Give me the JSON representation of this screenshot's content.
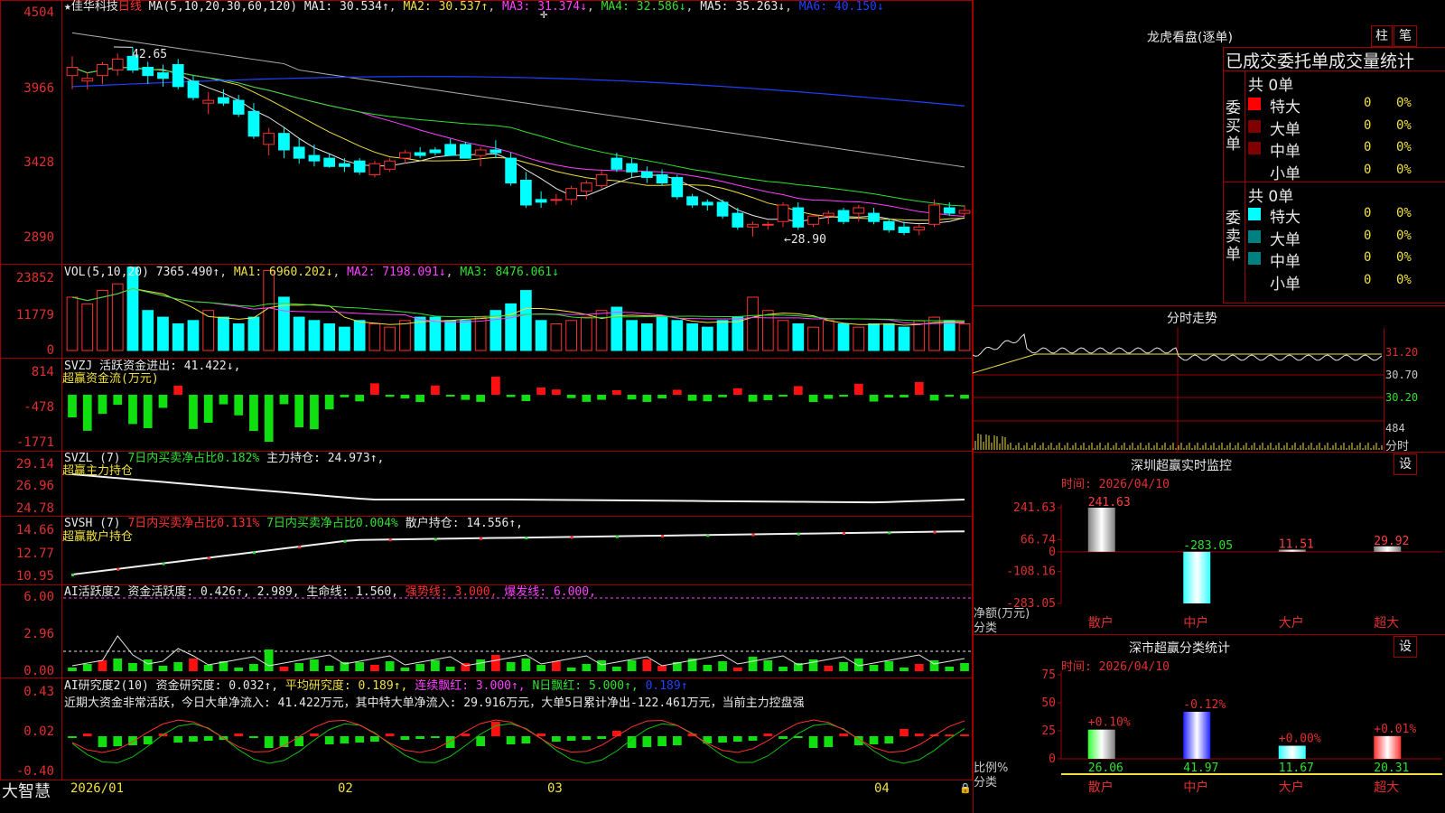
{
  "left": {
    "main": {
      "name": "★佳华科技",
      "period": "日线",
      "ma_params": "MA(5,10,20,30,60,120)",
      "ma1": "MA1: 30.534↑",
      "ma2": "MA2: 30.537↑",
      "ma3": "MA3: 31.374↓",
      "ma4": "MA4: 32.586↓",
      "ma5": "MA5: 35.263↓",
      "ma6": "MA6: 40.150↓",
      "y_ticks": [
        "4504",
        "3966",
        "3428",
        "2890"
      ],
      "high_mark": "42.65",
      "low_mark": "←28.90"
    },
    "vol": {
      "head": "VOL(5,10,20)",
      "value": "7365.490↑",
      "ma1": "MA1: 6960.202↓",
      "ma2": "MA2: 7198.091↓",
      "ma3": "MA3: 8476.061↓",
      "y_ticks": [
        "23852",
        "11779",
        "0"
      ]
    },
    "svzj": {
      "head": "SVZJ",
      "text": "活跃资金进出: 41.422↓,",
      "sub": "超赢资金流(万元)",
      "y_ticks": [
        "814",
        "-478",
        "-1771"
      ]
    },
    "svzl": {
      "head": "SVZL (7)",
      "t1": "7日内买卖净占比0.182%",
      "t2": "主力持仓: 24.973↑,",
      "sub": "超赢主力持仓",
      "y_ticks": [
        "29.14",
        "26.96",
        "24.78"
      ]
    },
    "svsh": {
      "head": "SVSH (7)",
      "t1": "7日内买卖净占比0.131%",
      "t2": "7日内买卖净占比0.004%",
      "t3": "散户持仓: 14.556↑,",
      "sub": "超赢散户持仓",
      "y_ticks": [
        "14.66",
        "12.77",
        "10.95"
      ]
    },
    "ai1": {
      "head": "AI活跃度2",
      "t1": "资金活跃度: 0.426↑,",
      "t2": "2.989,",
      "t3": "生命线: 1.560,",
      "t4": "强势线: 3.000,",
      "t5": "爆发线: 6.000,",
      "y_ticks": [
        "6.00",
        "2.96",
        "0.00"
      ]
    },
    "ai2": {
      "head": "AI研究度2(10)",
      "t1": "资金研究度: 0.032↑,",
      "t2": "平均研究度: 0.189↑,",
      "t3": "连续飘红: 3.000↑,",
      "t4": "N日飘红: 5.000↑,",
      "t5": "0.189↑",
      "note": "近期大资金非常活跃，今日大单净流入: 41.422万元，其中特大单净流入: 29.916万元，大单5日累计净出-122.461万元，当前主力控盘强",
      "y_ticks": [
        "0.43",
        "0.02",
        "-0.40"
      ]
    },
    "footer": {
      "brand": "大智慧",
      "dates": [
        "2026/01",
        "02",
        "03",
        "04"
      ]
    }
  },
  "right": {
    "lhb": {
      "title": "龙虎看盘(逐单)",
      "btn1": "柱",
      "btn2": "笔",
      "header": "已成交委托单成交量统计",
      "buy_label": "委买单",
      "sell_label": "委卖单",
      "buy_total": "共 0单",
      "sell_total": "共 0单",
      "rows": [
        "特大",
        "大单",
        "中单",
        "小单"
      ],
      "buy_colors": [
        "#ff0000",
        "#800000",
        "#800000",
        "#000000"
      ],
      "sell_colors": [
        "#00ffff",
        "#008080",
        "#008080",
        "#000000"
      ],
      "count": "0",
      "pct": "0%"
    },
    "fenshi": {
      "title": "分时走势",
      "y_ticks": [
        "31.20",
        "30.70",
        "30.20"
      ],
      "vol_tick": "484",
      "vol_label": "分时"
    },
    "sz": {
      "title": "深圳超赢实时监控",
      "btn": "设",
      "time": "时间: 2026/04/10",
      "y_ticks": [
        "241.63",
        "66.74",
        "0",
        "-108.16",
        "-283.05"
      ],
      "ylabel1": "净额(万元)",
      "ylabel2": "分类",
      "categories": [
        "散户",
        "中户",
        "大户",
        "超大"
      ],
      "values": [
        "241.63",
        "-283.05",
        "11.51",
        "29.92"
      ]
    },
    "sm": {
      "title": "深市超赢分类统计",
      "btn": "设",
      "time": "时间: 2026/04/10",
      "y_ticks": [
        "75",
        "50",
        "25",
        "0"
      ],
      "ylabel1": "比例%",
      "ylabel2": "分类",
      "categories": [
        "散户",
        "中户",
        "大户",
        "超大"
      ],
      "values": [
        "26.06",
        "41.97",
        "11.67",
        "20.31"
      ],
      "changes": [
        "+0.10%",
        "-0.12%",
        "+0.00%",
        "+0.01%"
      ]
    }
  },
  "chart_data": [
    {
      "type": "bar",
      "title": "深圳超赢实时监控",
      "ylabel": "净额(万元)",
      "categories": [
        "散户",
        "中户",
        "大户",
        "超大"
      ],
      "values": [
        241.63,
        -283.05,
        11.51,
        29.92
      ],
      "ylim": [
        -283.05,
        241.63
      ]
    },
    {
      "type": "bar",
      "title": "深市超赢分类统计",
      "ylabel": "比例%",
      "categories": [
        "散户",
        "中户",
        "大户",
        "超大"
      ],
      "values": [
        26.06,
        41.97,
        11.67,
        20.31
      ],
      "ylim": [
        0,
        75
      ]
    },
    {
      "type": "line",
      "title": "日线",
      "ylim": [
        28.9,
        45.04
      ],
      "candles": [
        [
          40.6,
          42.0,
          39.6,
          41.2
        ],
        [
          40.2,
          40.8,
          39.6,
          40.4
        ],
        [
          40.6,
          41.6,
          40.0,
          41.4
        ],
        [
          41.0,
          42.2,
          40.6,
          41.8
        ],
        [
          42.0,
          42.65,
          40.8,
          41.0
        ],
        [
          41.2,
          41.6,
          40.0,
          40.6
        ],
        [
          40.8,
          41.4,
          39.8,
          40.4
        ],
        [
          41.4,
          41.8,
          39.6,
          39.8
        ],
        [
          40.2,
          40.6,
          38.8,
          39.0
        ],
        [
          38.6,
          39.4,
          37.8,
          38.8
        ],
        [
          39.0,
          39.6,
          38.4,
          38.6
        ],
        [
          38.8,
          39.2,
          37.6,
          37.8
        ],
        [
          38.0,
          38.6,
          36.0,
          36.2
        ],
        [
          35.6,
          36.8,
          34.8,
          36.4
        ],
        [
          36.4,
          36.8,
          34.6,
          35.2
        ],
        [
          35.4,
          36.0,
          34.2,
          34.6
        ],
        [
          34.8,
          35.6,
          34.0,
          34.4
        ],
        [
          34.6,
          34.9,
          33.9,
          34.0
        ],
        [
          34.2,
          34.6,
          33.6,
          34.0
        ],
        [
          34.4,
          34.6,
          33.4,
          33.6
        ],
        [
          33.4,
          34.4,
          33.2,
          34.2
        ],
        [
          33.8,
          34.6,
          33.6,
          34.4
        ],
        [
          34.6,
          35.2,
          34.2,
          35.0
        ],
        [
          35.0,
          35.4,
          34.6,
          34.8
        ],
        [
          35.2,
          35.4,
          34.8,
          35.0
        ],
        [
          35.6,
          36.0,
          34.8,
          34.8
        ],
        [
          35.6,
          35.8,
          34.6,
          34.6
        ],
        [
          34.8,
          35.4,
          34.0,
          35.2
        ],
        [
          35.2,
          35.9,
          34.6,
          35.0
        ],
        [
          34.6,
          35.0,
          32.6,
          32.8
        ],
        [
          33.0,
          33.6,
          31.0,
          31.2
        ],
        [
          31.6,
          32.2,
          31.0,
          31.4
        ],
        [
          31.6,
          32.0,
          31.2,
          31.6
        ],
        [
          31.6,
          32.6,
          31.2,
          32.4
        ],
        [
          32.2,
          33.0,
          31.6,
          32.8
        ],
        [
          32.6,
          33.8,
          32.4,
          33.4
        ],
        [
          34.6,
          35.0,
          33.6,
          33.8
        ],
        [
          34.2,
          34.6,
          33.2,
          33.6
        ],
        [
          33.6,
          34.0,
          32.8,
          33.2
        ],
        [
          33.4,
          33.8,
          32.6,
          32.8
        ],
        [
          33.2,
          33.4,
          31.6,
          31.8
        ],
        [
          31.8,
          32.0,
          31.0,
          31.2
        ],
        [
          31.4,
          31.6,
          30.8,
          31.2
        ],
        [
          31.4,
          31.6,
          30.2,
          30.4
        ],
        [
          30.6,
          31.0,
          29.4,
          29.6
        ],
        [
          29.6,
          30.0,
          28.9,
          29.8
        ],
        [
          29.8,
          30.0,
          29.4,
          29.8
        ],
        [
          30.0,
          31.4,
          29.6,
          31.2
        ],
        [
          31.0,
          31.4,
          29.4,
          29.6
        ],
        [
          29.8,
          30.4,
          29.6,
          30.4
        ],
        [
          30.4,
          30.8,
          29.8,
          30.6
        ],
        [
          30.8,
          31.0,
          29.8,
          30.0
        ],
        [
          30.6,
          31.2,
          30.0,
          31.0
        ],
        [
          30.6,
          31.0,
          29.8,
          30.0
        ],
        [
          30.0,
          30.2,
          29.2,
          29.4
        ],
        [
          29.6,
          30.0,
          29.0,
          29.2
        ],
        [
          29.4,
          29.8,
          29.0,
          29.6
        ],
        [
          29.8,
          31.6,
          29.6,
          31.2
        ],
        [
          31.0,
          31.4,
          30.4,
          30.6
        ],
        [
          30.6,
          31.2,
          30.4,
          30.8
        ]
      ]
    }
  ]
}
